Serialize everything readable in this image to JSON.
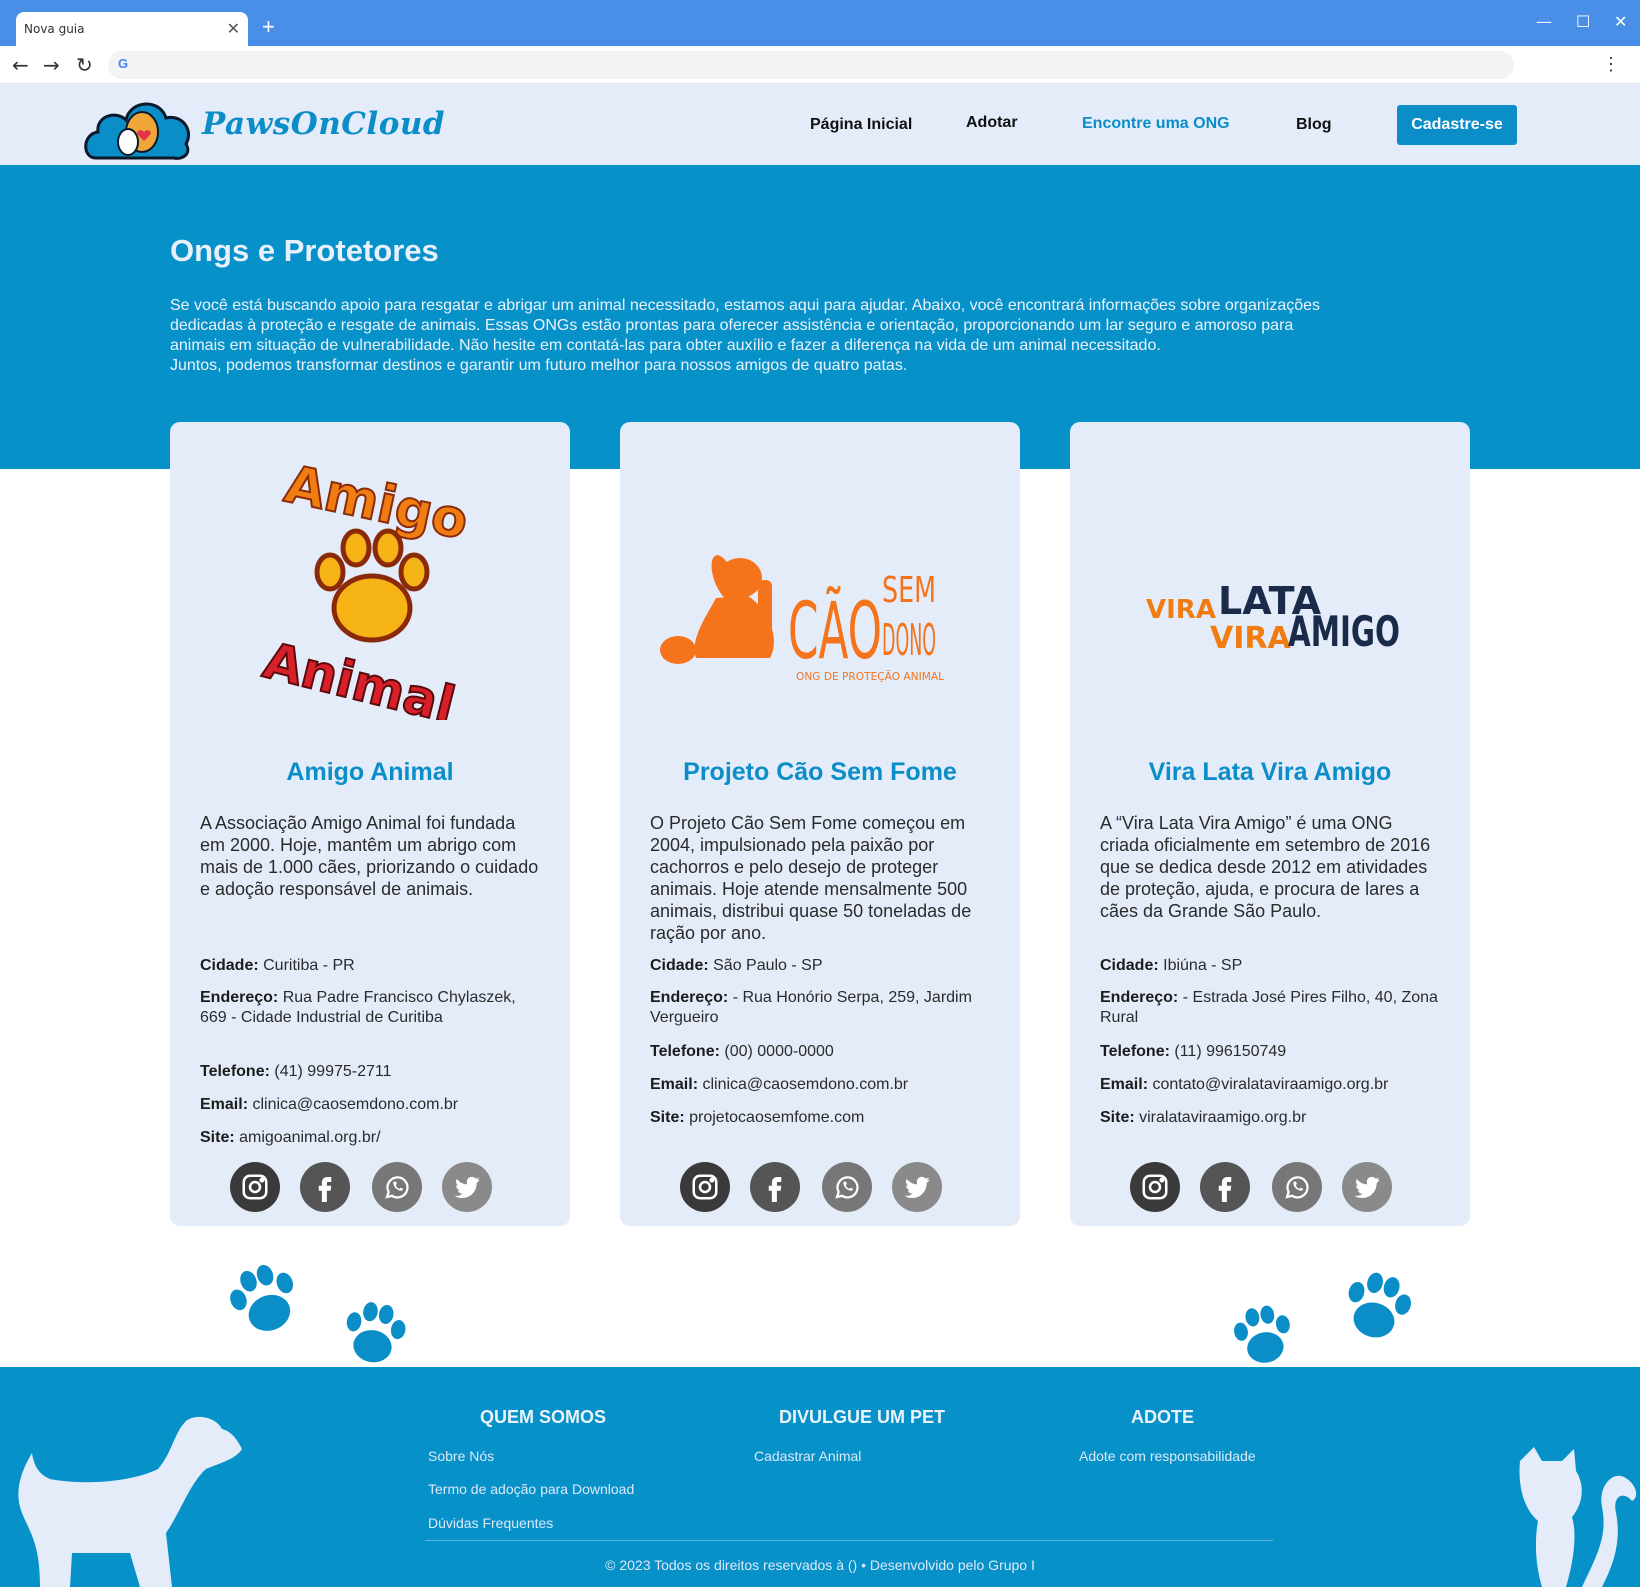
{
  "browser": {
    "tab_title": "Nova guia",
    "tab_close": "✕",
    "new_tab": "+",
    "minimize": "—",
    "maximize": "☐",
    "close": "✕",
    "back": "←",
    "forward": "→",
    "reload": "↻",
    "google_icon": "G",
    "menu": "⋮"
  },
  "site": {
    "logo_text": "PawsOnCloud",
    "nav": [
      {
        "label": "Página Inicial"
      },
      {
        "label": "Adotar"
      },
      {
        "label": "Encontre uma ONG"
      },
      {
        "label": "Blog"
      }
    ],
    "cta": "Cadastre-se",
    "colors": {
      "brand": "#0b8ec8",
      "hero": "#0791c9",
      "card": "#e4ecfa"
    }
  },
  "hero": {
    "title": "Ongs e Protetores",
    "lines": [
      "Se você está buscando apoio para resgatar e abrigar um animal necessitado, estamos aqui para ajudar. Abaixo, você encontrará informações sobre organizações",
      "dedicadas à proteção e resgate de animais. Essas ONGs estão prontas para oferecer assistência e orientação, proporcionando um lar seguro e amoroso para",
      "animais em situação de vulnerabilidade. Não hesite em contatá-las para obter auxílio e fazer a diferença na vida de um animal necessitado.",
      "Juntos, podemos transformar destinos e garantir um futuro melhor para nossos amigos de quatro patas."
    ]
  },
  "cards": [
    {
      "logo": {
        "top": "Amigo",
        "bottom": "Animal"
      },
      "name": "Amigo Animal",
      "desc": "A Associação Amigo Animal foi fundada em 2000. Hoje, mantêm um abrigo com mais de 1.000 cães, priorizando o cuidado e adoção responsável de animais.",
      "city_label": "Cidade:",
      "city": " Curitiba - PR",
      "address_label": "Endereço:",
      "address": " Rua Padre Francisco Chylaszek, 669 - Cidade Industrial de Curitiba",
      "phone_label": "Telefone:",
      "phone": " (41) 99975-2711",
      "email_label": "Email:",
      "email": " clinica@caosemdono.com.br",
      "site_label": "Site:",
      "site": " amigoanimal.org.br/"
    },
    {
      "logo": {
        "cao": "CÃO",
        "sem": "SEM",
        "dono": "DONO",
        "tagline": "ONG DE PROTEÇÃO ANIMAL"
      },
      "name": "Projeto Cão Sem Fome",
      "desc": "O Projeto Cão Sem Fome começou em 2004, impulsionado pela paixão por cachorros e pelo desejo de proteger animais. Hoje atende mensalmente 500 animais, distribui quase 50 toneladas de ração por ano.",
      "city_label": "Cidade:",
      "city": "  São Paulo - SP",
      "address_label": "Endereço:",
      "address": " - Rua Honório Serpa, 259, Jardim Vergueiro",
      "phone_label": "Telefone:",
      "phone": " (00) 0000-0000",
      "email_label": "Email:",
      "email": " clinica@caosemdono.com.br",
      "site_label": "Site:",
      "site": " projetocaosemfome.com"
    },
    {
      "logo": {
        "vira1": "VIRA",
        "lata": "LATA",
        "vira2": "VIRA",
        "amigo": "AMIGO"
      },
      "name": "Vira Lata Vira Amigo",
      "desc": "A “Vira Lata Vira Amigo” é uma ONG criada oficialmente em setembro de 2016 que se dedica desde 2012 em atividades de proteção, ajuda, e procura de lares a cães da Grande São Paulo.",
      "city_label": "Cidade:",
      "city": " Ibiúna - SP",
      "address_label": "Endereço:",
      "address": " - Estrada José Pires Filho, 40, Zona Rural",
      "phone_label": "Telefone:",
      "phone": " (11) 996150749",
      "email_label": "Email:",
      "email": " contato@viralataviraamigo.org.br",
      "site_label": "Site:",
      "site": " viralataviraamigo.org.br"
    }
  ],
  "social_icons": [
    "instagram-icon",
    "facebook-icon",
    "whatsapp-icon",
    "twitter-icon"
  ],
  "footer": {
    "col1": {
      "title": "QUEM SOMOS",
      "links": [
        "Sobre Nós",
        "Termo de adoção para Download",
        "Dúvidas Frequentes"
      ]
    },
    "col2": {
      "title": "DIVULGUE UM PET",
      "links": [
        "Cadastrar Animal"
      ]
    },
    "col3": {
      "title": "ADOTE",
      "links": [
        "Adote com responsabilidade"
      ]
    },
    "copyright": "© 2023 Todos os direitos reservados à () • Desenvolvido pelo Grupo I"
  }
}
